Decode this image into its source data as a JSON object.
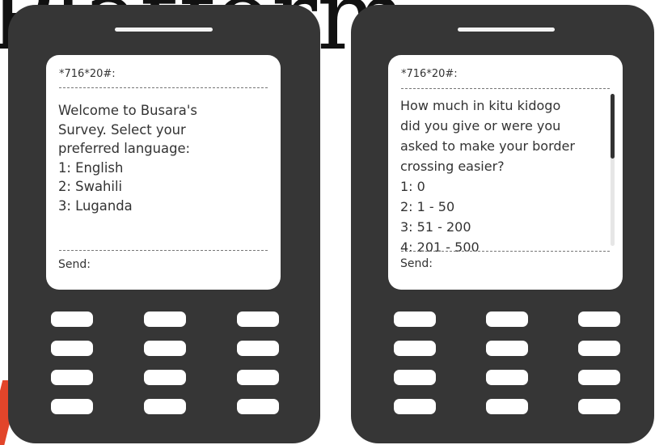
{
  "background_title": "Platform",
  "colors": {
    "phone_body": "#363636",
    "screen": "#ffffff",
    "text": "#333333",
    "accent_red": "#e2452a"
  },
  "phones": [
    {
      "ussd_code": "*716*20#:",
      "message_lines": [
        "Welcome to Busara's",
        "Survey. Select your",
        "preferred language:"
      ],
      "options": [
        "1: English",
        "2: Swahili",
        "3: Luganda"
      ],
      "send_label": "Send:",
      "keys": 12
    },
    {
      "ussd_code": "*716*20#:",
      "message_lines": [
        "How much in kitu kidogo",
        "did you give or were you",
        "asked to make your border",
        "crossing easier?"
      ],
      "options": [
        "1: 0",
        "2: 1 - 50",
        "3: 51 - 200",
        "4: 201 - 500"
      ],
      "send_label": "Send:",
      "keys": 12
    }
  ]
}
